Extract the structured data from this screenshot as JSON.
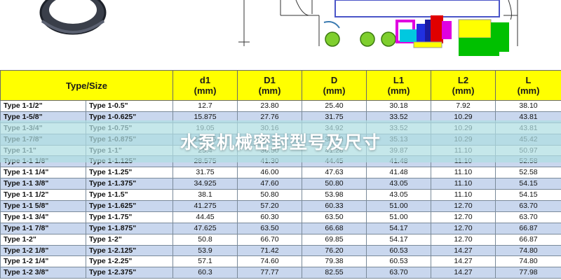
{
  "banner": {
    "title": "水泵机械密封型号及尺寸"
  },
  "table": {
    "headers": [
      {
        "label": "Type/Size",
        "unit": ""
      },
      {
        "label": "d1",
        "unit": "(mm)"
      },
      {
        "label": "D1",
        "unit": "(mm)"
      },
      {
        "label": "D",
        "unit": "(mm)"
      },
      {
        "label": "L1",
        "unit": "(mm)"
      },
      {
        "label": "L2",
        "unit": "(mm)"
      },
      {
        "label": "L",
        "unit": "(mm)"
      }
    ],
    "rows": [
      [
        "Type 1-1/2\"",
        "Type 1-0.5\"",
        "12.7",
        "23.80",
        "25.40",
        "30.18",
        "7.92",
        "38.10"
      ],
      [
        "Type 1-5/8\"",
        "Type 1-0.625\"",
        "15.875",
        "27.76",
        "31.75",
        "33.52",
        "10.29",
        "43.81"
      ],
      [
        "Type 1-3/4\"",
        "Type 1-0.75\"",
        "19.05",
        "30.16",
        "34.92",
        "33.52",
        "10.29",
        "43.81"
      ],
      [
        "Type 1-7/8\"",
        "Type 1-0.875\"",
        "22.225",
        "34.13",
        "38.10",
        "35.13",
        "10.29",
        "45.42"
      ],
      [
        "Type 1-1\"",
        "Type 1-1\"",
        "25.4",
        "36.50",
        "41.28",
        "39.87",
        "11.10",
        "50.97"
      ],
      [
        "Type 1-1 1/8\"",
        "Type 1-1.125\"",
        "28.575",
        "41.30",
        "44.45",
        "41.48",
        "11.10",
        "52.58"
      ],
      [
        "Type 1-1 1/4\"",
        "Type 1-1.25\"",
        "31.75",
        "46.00",
        "47.63",
        "41.48",
        "11.10",
        "52.58"
      ],
      [
        "Type 1-1 3/8\"",
        "Type 1-1.375\"",
        "34.925",
        "47.60",
        "50.80",
        "43.05",
        "11.10",
        "54.15"
      ],
      [
        "Type 1-1 1/2\"",
        "Type 1-1.5\"",
        "38.1",
        "50.80",
        "53.98",
        "43.05",
        "11.10",
        "54.15"
      ],
      [
        "Type 1-1 5/8\"",
        "Type 1-1.625\"",
        "41.275",
        "57.20",
        "60.33",
        "51.00",
        "12.70",
        "63.70"
      ],
      [
        "Type 1-1 3/4\"",
        "Type 1-1.75\"",
        "44.45",
        "60.30",
        "63.50",
        "51.00",
        "12.70",
        "63.70"
      ],
      [
        "Type 1-1 7/8\"",
        "Type 1-1.875\"",
        "47.625",
        "63.50",
        "66.68",
        "54.17",
        "12.70",
        "66.87"
      ],
      [
        "Type 1-2\"",
        "Type 1-2\"",
        "50.8",
        "66.70",
        "69.85",
        "54.17",
        "12.70",
        "66.87"
      ],
      [
        "Type 1-2 1/8\"",
        "Type 1-2.125\"",
        "53.9",
        "71.42",
        "76.20",
        "60.53",
        "14.27",
        "74.80"
      ],
      [
        "Type 1-2 1/4\"",
        "Type 1-2.25\"",
        "57.1",
        "74.60",
        "79.38",
        "60.53",
        "14.27",
        "74.80"
      ],
      [
        "Type 1-2 3/8\"",
        "Type 1-2.375\"",
        "60.3",
        "77.77",
        "82.55",
        "63.70",
        "14.27",
        "77.98"
      ]
    ]
  },
  "colors": {
    "header_bg": "#ffff00",
    "row_alt_bg": "#c9d7ee",
    "banner_bg": "#afdee2",
    "seal_green": "#00c000",
    "seal_yellow": "#ffff00",
    "seal_magenta": "#e000e0",
    "seal_red": "#e00000",
    "seal_blue": "#2030e0",
    "seal_cyan": "#00c8e0"
  }
}
